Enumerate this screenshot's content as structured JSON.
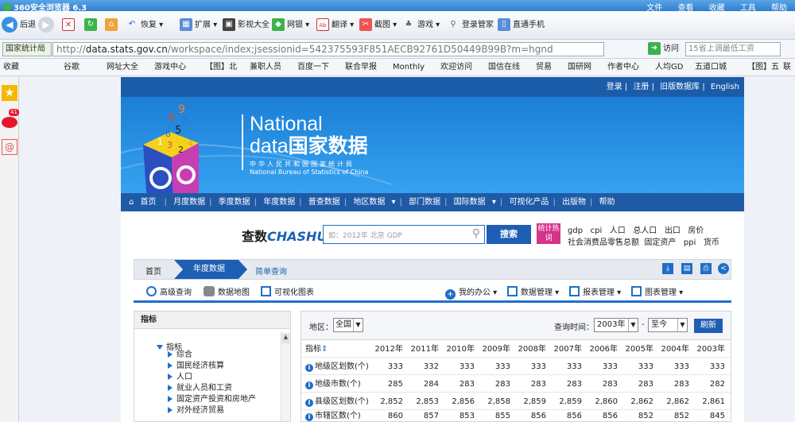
{
  "browser": {
    "title": "360安全浏览器 6.3",
    "menu": [
      "文件",
      "查看",
      "收藏",
      "工具",
      "帮助"
    ],
    "nav": {
      "back": "后退",
      "restore": "恢复",
      "extend": "扩展",
      "video": "影视大全",
      "bank": "网银",
      "translate": "翻译",
      "screenshot": "截图",
      "games": "游戏",
      "login_mgr": "登录管家",
      "phone": "直通手机"
    },
    "site_label": "国家统计局",
    "url_host": "data.stats.gov.cn",
    "url_prefix": "http://",
    "url_path": "/workspace/index;jsessionid=542375593F851AECB92761D50449B99B?m=hgnd",
    "go_label": "访问",
    "search_placeholder": "15省上调最低工资",
    "bookmarks": [
      "收藏",
      "谷歌",
      "网址大全",
      "游戏中心",
      "【图】北",
      "兼职人员",
      "百度一下",
      "联合早报",
      "Monthly",
      "欢迎访问",
      "国信在线",
      "贸易",
      "国研网",
      "作者中心",
      "人均GD",
      "五道口城",
      "【图】五",
      "联"
    ]
  },
  "sidebar": {
    "badge": "41"
  },
  "site": {
    "toplinks": [
      "登录",
      "注册",
      "旧版数据库",
      "English"
    ],
    "banner": {
      "national": "National",
      "data": "data",
      "cn_title": "国家数据",
      "cn_org": "中华人民共和国国家统计局",
      "en_org": "National Bureau of Statistics of China"
    },
    "mainnav": [
      "首页",
      "月度数据",
      "季度数据",
      "年度数据",
      "普查数据",
      "地区数据",
      "部门数据",
      "国际数据",
      "可视化产品",
      "出版物",
      "帮助"
    ],
    "search": {
      "brand_cn": "查数",
      "brand_en": "CHASHU",
      "placeholder": "如：2012年 北京 GDP",
      "button": "搜索",
      "hot_label": "统计热词",
      "hot_row1": [
        "gdp",
        "cpi",
        "人口",
        "总人口",
        "出口",
        "房价"
      ],
      "hot_row2": [
        "社会消费品零售总额",
        "固定资产",
        "ppi",
        "货币"
      ]
    },
    "crumbs": [
      "首页",
      "年度数据",
      "简单查询"
    ],
    "tools": {
      "advanced": "高级查询",
      "map": "数据地图",
      "visual": "可视化图表",
      "my_office": "我的办公",
      "data_mgmt": "数据管理",
      "report_mgmt": "报表管理",
      "chart_mgmt": "图表管理"
    },
    "left_panel": {
      "header": "指标",
      "root": "指标",
      "items": [
        "综合",
        "国民经济核算",
        "人口",
        "就业人员和工资",
        "固定资产投资和房地产",
        "对外经济贸易"
      ]
    },
    "right_panel": {
      "region_label": "地区：",
      "region_value": "全国",
      "time_label": "查询时间：",
      "from_year": "2003年",
      "dash": "-",
      "to_value": "至今",
      "refresh": "刷新",
      "col_header": "指标",
      "years": [
        "2012年",
        "2011年",
        "2010年",
        "2009年",
        "2008年",
        "2007年",
        "2006年",
        "2005年",
        "2004年",
        "2003年"
      ],
      "rows": [
        {
          "name": "地级区划数(个)",
          "values": [
            "333",
            "332",
            "333",
            "333",
            "333",
            "333",
            "333",
            "333",
            "333",
            "333"
          ]
        },
        {
          "name": "地级市数(个)",
          "values": [
            "285",
            "284",
            "283",
            "283",
            "283",
            "283",
            "283",
            "283",
            "283",
            "282"
          ]
        },
        {
          "name": "县级区划数(个)",
          "values": [
            "2,852",
            "2,853",
            "2,856",
            "2,858",
            "2,859",
            "2,859",
            "2,860",
            "2,862",
            "2,862",
            "2,861"
          ]
        },
        {
          "name": "市辖区数(个)",
          "values": [
            "860",
            "857",
            "853",
            "855",
            "856",
            "856",
            "856",
            "852",
            "852",
            "845"
          ]
        }
      ]
    }
  }
}
